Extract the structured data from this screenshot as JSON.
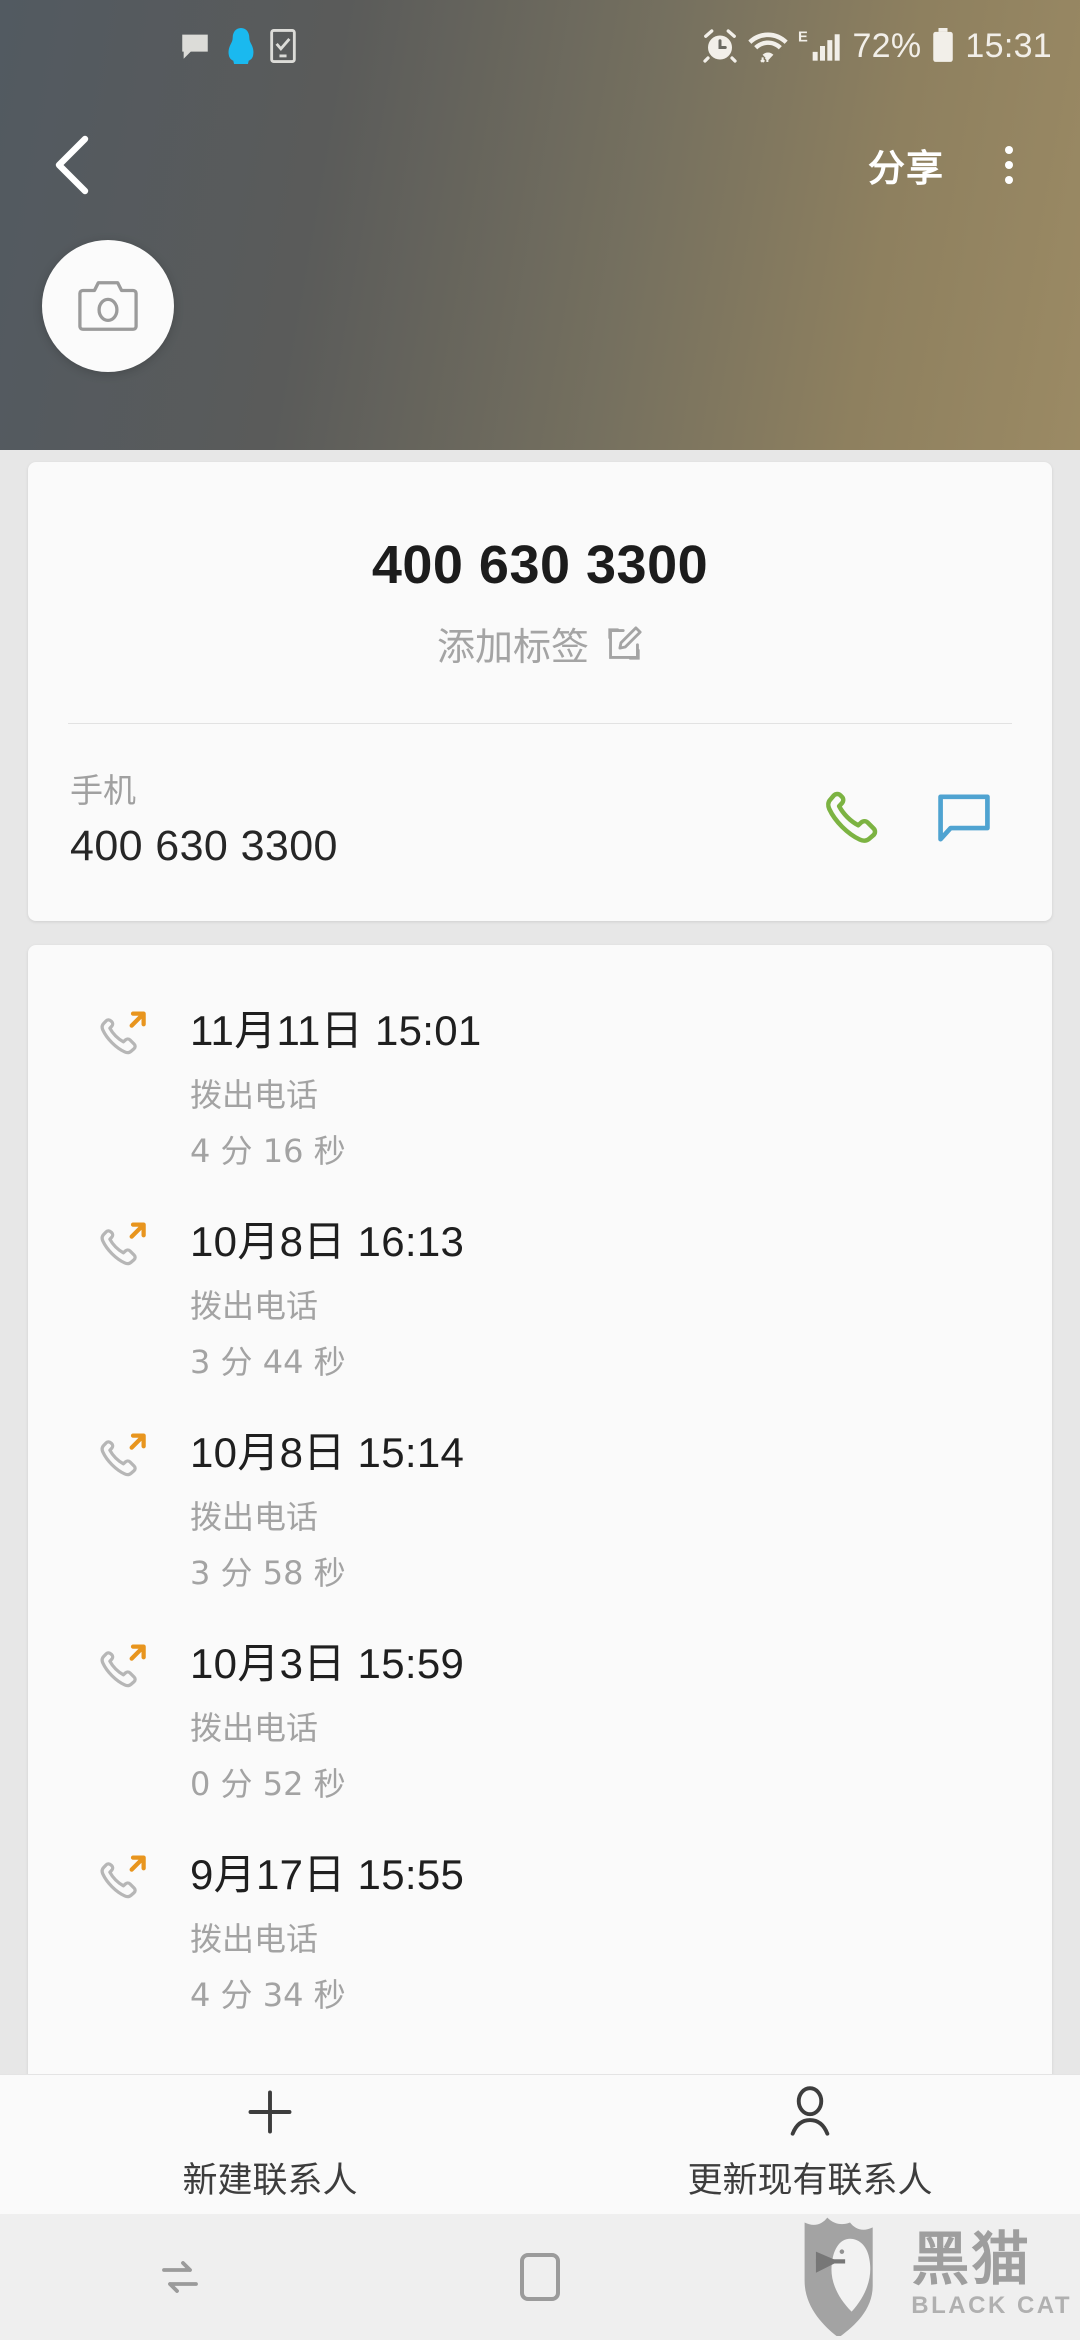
{
  "statusbar": {
    "left_icons": [
      "message-bubble-icon",
      "qq-penguin-icon",
      "task-checklist-icon"
    ],
    "right_icons": [
      "alarm-clock-icon",
      "wifi-icon",
      "edge-signal-icon",
      "battery-icon"
    ],
    "battery_percent": "72%",
    "clock": "15:31"
  },
  "toolbar": {
    "back_label": "‹",
    "share_label": "分享",
    "overflow_label": "more-options"
  },
  "contact": {
    "avatar_icon": "camera-icon",
    "name": "400 630 3300",
    "add_label_text": "添加标签",
    "edit_icon": "edit-pencil-icon",
    "phone_type": "手机",
    "phone_number": "400 630 3300",
    "call_icon": "phone-handset-icon",
    "message_icon": "message-bubble-icon",
    "call_color": "#7cb342",
    "message_color": "#4fa3d1"
  },
  "call_log": {
    "outgoing_arrow_color": "#e8951e",
    "items": [
      {
        "date": "11月11日 15:01",
        "type": "拨出电话",
        "duration": "4 分 16 秒",
        "icon": "outgoing-call-icon"
      },
      {
        "date": "10月8日 16:13",
        "type": "拨出电话",
        "duration": "3 分 44 秒",
        "icon": "outgoing-call-icon"
      },
      {
        "date": "10月8日 15:14",
        "type": "拨出电话",
        "duration": "3 分 58 秒",
        "icon": "outgoing-call-icon"
      },
      {
        "date": "10月3日 15:59",
        "type": "拨出电话",
        "duration": "0 分 52 秒",
        "icon": "outgoing-call-icon"
      },
      {
        "date": "9月17日 15:55",
        "type": "拨出电话",
        "duration": "4 分 34 秒",
        "icon": "outgoing-call-icon"
      }
    ]
  },
  "bottom_bar": {
    "new_contact_icon": "plus-icon",
    "new_contact_label": "新建联系人",
    "update_contact_icon": "person-icon",
    "update_contact_label": "更新现有联系人"
  },
  "navbar": {
    "recents_icon": "recents-icon",
    "home_icon": "home-icon"
  },
  "watermark": {
    "logo_icon": "black-cat-shield-logo",
    "cn_text": "黑猫",
    "en_text": "BLACK CAT"
  }
}
